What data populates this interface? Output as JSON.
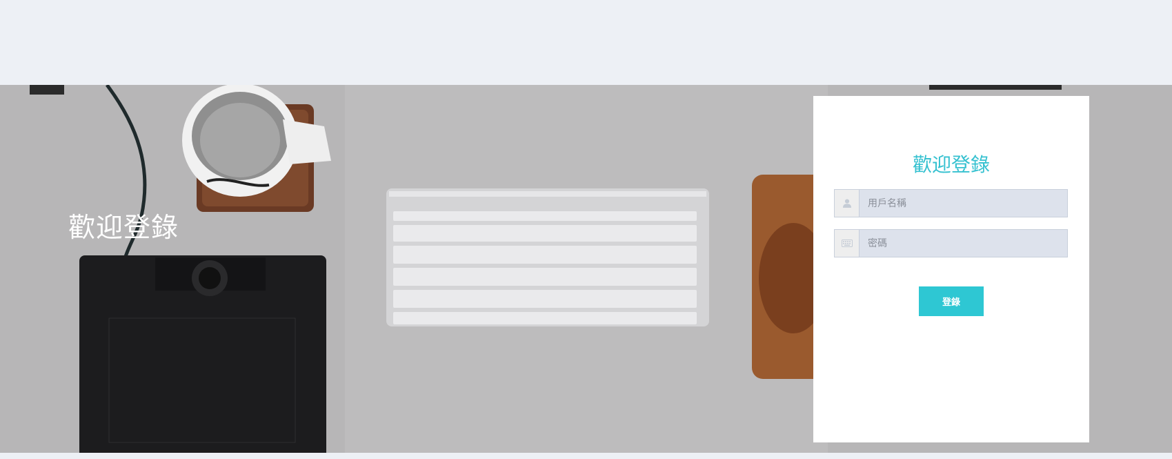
{
  "hero": {
    "title": "歡迎登錄"
  },
  "login": {
    "title": "歡迎登錄",
    "username": {
      "placeholder": "用戶名稱",
      "value": "",
      "icon": "user-icon"
    },
    "password": {
      "placeholder": "密碼",
      "value": "",
      "icon": "keyboard-icon"
    },
    "submit_label": "登錄"
  },
  "colors": {
    "page_bg": "#edf0f5",
    "accent": "#35c1d0",
    "button": "#2ec7d3",
    "input_bg": "#dde2ec"
  }
}
